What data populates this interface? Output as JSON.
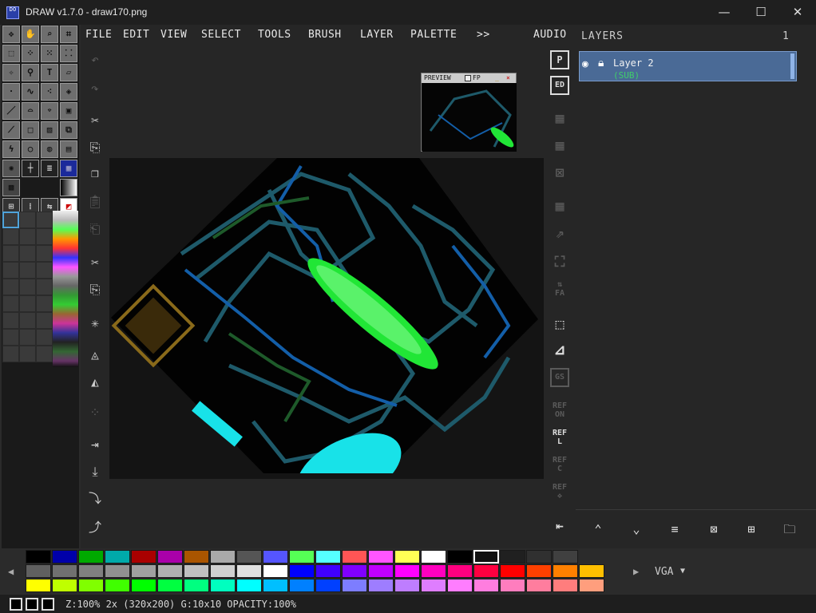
{
  "window": {
    "title": "DRAW v1.7.0 - draw170.png",
    "app_icon_text": "DO",
    "minimize": "—",
    "maximize": "☐",
    "close": "✕"
  },
  "menu": {
    "items": [
      "FILE",
      "EDIT",
      "VIEW",
      "SELECT",
      "TOOLS",
      "BRUSH",
      "LAYER",
      "PALETTE",
      ">>"
    ],
    "right": "AUDIO"
  },
  "layers": {
    "title": "LAYERS",
    "count": "1",
    "items": [
      {
        "name": "Layer 2",
        "mode": "(SUB)"
      }
    ]
  },
  "preview": {
    "title": "PREVIEW",
    "fp_label": "FP",
    "min": "_",
    "close": "×"
  },
  "right_tools": {
    "ref_on": "REF ON",
    "ref_l": "REF L",
    "ref_c": "REF C",
    "ref_move": "REF ✥",
    "gs": "GS",
    "fa": "FA"
  },
  "palette": {
    "name": "VGA",
    "row1": [
      "#000000",
      "#0000aa",
      "#00aa00",
      "#00aaaa",
      "#aa0000",
      "#aa00aa",
      "#aa5500",
      "#aaaaaa",
      "#555555",
      "#5555ff",
      "#55ff55",
      "#55ffff",
      "#ff5555",
      "#ff55ff",
      "#ffff55",
      "#ffffff",
      "#000000",
      "#101010",
      "#202020",
      "#303030",
      "#404040"
    ],
    "row2": [
      "#606060",
      "#707070",
      "#808080",
      "#909090",
      "#a0a0a0",
      "#b0b0b0",
      "#c0c0c0",
      "#d0d0d0",
      "#e0e0e0",
      "#ffffff",
      "#0000ff",
      "#4000ff",
      "#8000ff",
      "#bf00ff",
      "#ff00ff",
      "#ff00bf",
      "#ff0080",
      "#ff0040",
      "#ff0000",
      "#ff4000",
      "#ff8000",
      "#ffbf00"
    ],
    "row3": [
      "#ffff00",
      "#bfff00",
      "#80ff00",
      "#40ff00",
      "#00ff00",
      "#00ff40",
      "#00ff80",
      "#00ffbf",
      "#00ffff",
      "#00bfff",
      "#0080ff",
      "#0040ff",
      "#7d7dff",
      "#9e7dff",
      "#be7dff",
      "#df7dff",
      "#ff7dff",
      "#ff7ddf",
      "#ff7dbe",
      "#ff7d9e",
      "#ff7d7d",
      "#ff9e7d"
    ]
  },
  "status": {
    "text": "Z:100% 2x (320x200) G:10x10 OPACITY:100%"
  },
  "colors": {
    "accent": "#4a6a96",
    "layer_mode": "#3fcf6a",
    "canvas_green": "#21e636",
    "canvas_cyan": "#18e2e8"
  }
}
